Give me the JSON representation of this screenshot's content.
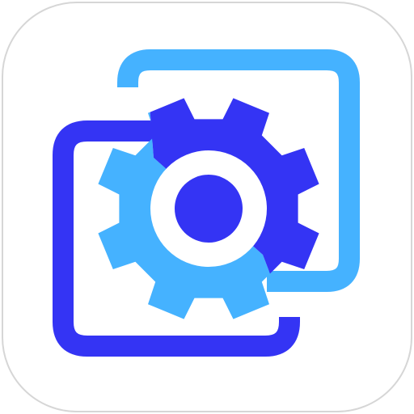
{
  "app_icon": {
    "icon_name": "settings-gear-icon",
    "colors": {
      "tile_background": "#ffffff",
      "tile_border": "#d6d6d6",
      "front_frame": "#3434f4",
      "back_frame": "#45b2ff",
      "gear_back_half": "#45b2ff",
      "gear_front_half": "#3434f4",
      "gear_center": "#3434f4"
    }
  }
}
